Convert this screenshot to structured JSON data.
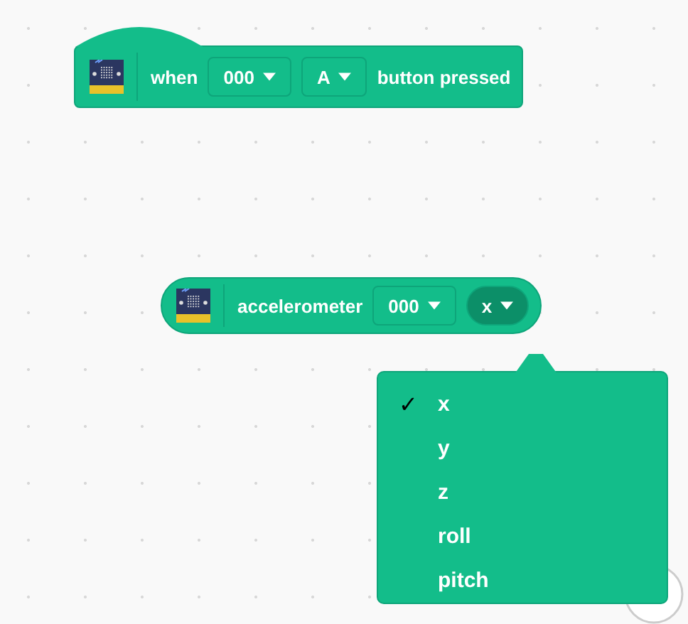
{
  "hat_block": {
    "label_1": "when",
    "dropdown_1": "000",
    "dropdown_2": "A",
    "label_2": "button pressed"
  },
  "reporter_block": {
    "label": "accelerometer",
    "dropdown_1": "000",
    "dropdown_2": {
      "value": "x",
      "open": true
    }
  },
  "dropdown_menu": {
    "check_mark": "✓",
    "items": [
      {
        "label": "x",
        "selected": true
      },
      {
        "label": "y",
        "selected": false
      },
      {
        "label": "z",
        "selected": false
      },
      {
        "label": "roll",
        "selected": false
      },
      {
        "label": "pitch",
        "selected": false
      }
    ]
  }
}
